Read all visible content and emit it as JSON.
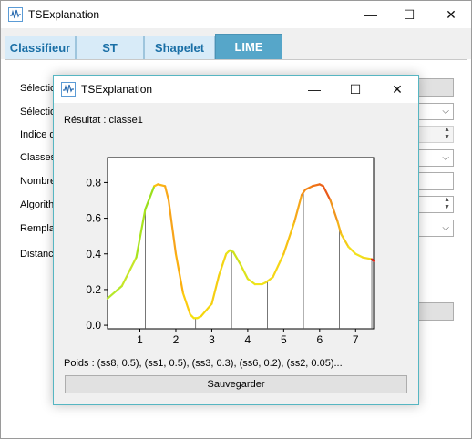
{
  "main_window": {
    "title": "TSExplanation",
    "controls": {
      "minimize": "—",
      "maximize": "☐",
      "close": "✕"
    },
    "tabs": [
      {
        "label": "Classifieur",
        "active": false
      },
      {
        "label": "ST",
        "active": false
      },
      {
        "label": "Shapelet",
        "active": false
      },
      {
        "label": "LIME",
        "active": true
      }
    ],
    "form_labels": [
      "Sélectio",
      "Sélectio",
      "Indice d",
      "Classes",
      "Nombre",
      "Algorith",
      "Remplac",
      "Distance"
    ]
  },
  "dialog": {
    "title": "TSExplanation",
    "controls": {
      "minimize": "—",
      "maximize": "☐",
      "close": "✕"
    },
    "result_text": "Résultat : classe1",
    "weights_text": "Poids : (ss8, 0.5), (ss1, 0.5), (ss3, 0.3), (ss6, 0.2), (ss2, 0.05)...",
    "save_label": "Sauvegarder"
  },
  "colors": {
    "accent_tab": "#56a6c9",
    "dialog_border": "#56b6c2",
    "low_importance": "#9be01c",
    "mid_importance": "#f5d60c",
    "high_importance": "#f08c1a",
    "top_importance": "#e8281a"
  },
  "chart_data": {
    "type": "line",
    "x_ticks": [
      1,
      2,
      3,
      4,
      5,
      6,
      7
    ],
    "y_ticks": [
      0.0,
      0.2,
      0.4,
      0.6,
      0.8
    ],
    "xlim": [
      0.1,
      7.5
    ],
    "ylim": [
      -0.02,
      0.94
    ],
    "grid": false,
    "segment_boundaries": [
      1.15,
      2.55,
      3.55,
      4.55,
      5.55,
      6.55,
      7.45
    ],
    "series": [
      {
        "x": [
          0.1,
          0.5,
          0.9,
          1.15,
          1.4,
          1.5,
          1.7,
          1.8,
          2.0,
          2.2,
          2.4,
          2.5,
          2.6,
          2.7,
          3.0,
          3.2,
          3.4,
          3.5,
          3.6,
          3.8,
          4.0,
          4.2,
          4.4,
          4.5,
          4.7,
          5.0,
          5.3,
          5.5,
          5.6,
          5.8,
          6.0,
          6.1,
          6.3,
          6.5,
          6.6,
          6.8,
          7.0,
          7.2,
          7.45,
          7.5
        ],
        "y": [
          0.15,
          0.22,
          0.38,
          0.65,
          0.78,
          0.79,
          0.78,
          0.7,
          0.4,
          0.18,
          0.06,
          0.04,
          0.04,
          0.05,
          0.12,
          0.28,
          0.4,
          0.42,
          0.41,
          0.34,
          0.26,
          0.23,
          0.23,
          0.24,
          0.27,
          0.4,
          0.58,
          0.73,
          0.76,
          0.78,
          0.79,
          0.78,
          0.7,
          0.58,
          0.51,
          0.44,
          0.4,
          0.38,
          0.37,
          0.36
        ],
        "colors": [
          "#b6e82a",
          "#c6e628",
          "#a8e41e",
          "#9be01c",
          "#fcc20e",
          "#fbb414",
          "#f9a91a",
          "#f7a41a",
          "#fbb010",
          "#fccc0f",
          "#f7df10",
          "#f2e30f",
          "#f4e10f",
          "#f5d60c",
          "#f5ce12",
          "#f3d514",
          "#e8e41a",
          "#c9e51f",
          "#cfe21a",
          "#dbe31d",
          "#e7e41a",
          "#f2e41a",
          "#f0e21a",
          "#f2dd18",
          "#f6d616",
          "#f7c214",
          "#f6a81a",
          "#f59018",
          "#f28316",
          "#ef7016",
          "#ed6418",
          "#ea5a1a",
          "#f0941c",
          "#f4b31a",
          "#f3cc1a",
          "#f4dd1c",
          "#f0e21e",
          "#f3d91c",
          "#e8281a",
          "#e8281a"
        ]
      }
    ]
  }
}
